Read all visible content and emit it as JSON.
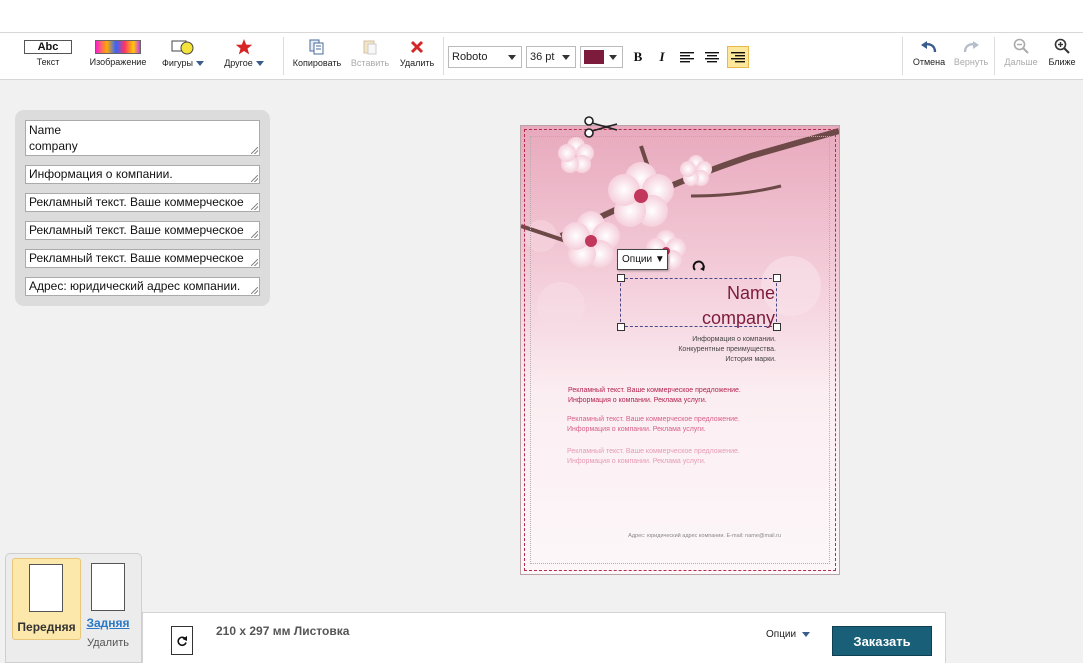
{
  "toolbar": {
    "text_label": "Текст",
    "text_icon": "Abc",
    "image_label": "Изображение",
    "shapes_label": "Фигуры",
    "other_label": "Другое",
    "copy_label": "Копировать",
    "paste_label": "Вставить",
    "delete_label": "Удалить",
    "font_family": "Roboto",
    "font_size": "36 pt",
    "text_color": "#7d1b3c",
    "bold": "B",
    "italic": "I",
    "undo_label": "Отмена",
    "redo_label": "Вернуть",
    "zoom_out_label": "Дальше",
    "zoom_in_label": "Ближе"
  },
  "fields": [
    {
      "line1": "Name",
      "line2": "company"
    },
    {
      "value": "Информация о компании."
    },
    {
      "value": "Рекламный текст. Ваше коммерческое"
    },
    {
      "value": "Рекламный текст. Ваше коммерческое"
    },
    {
      "value": "Рекламный текст. Ваше коммерческое"
    },
    {
      "value": "Адрес: юридический адрес компании."
    }
  ],
  "canvas": {
    "options_label": "Опции ▼",
    "name_line1": "Name",
    "name_line2": "company",
    "info_line1": "Информация о компании.",
    "info_line2": "Конкурентные преимущества.",
    "info_line3": "История марки.",
    "ad1_line1": "Рекламный текст. Ваше коммерческое предложение.",
    "ad1_line2": "Информация о компании. Реклама услуги.",
    "ad2_line1": "Рекламный текст. Ваше коммерческое предложение.",
    "ad2_line2": "Информация о компании. Реклама услуги.",
    "ad3_line1": "Рекламный текст. Ваше коммерческое предложение.",
    "ad3_line2": "Информация о компании. Реклама услуги.",
    "footer": "Адрес: юридический адрес компании. E-mail: name@mail.ru"
  },
  "pages": {
    "front_label": "Передняя",
    "back_label": "Задняя",
    "delete_label": "Удалить"
  },
  "bottom": {
    "size_text": "210 x 297 мм Листовка",
    "options_label": "Опции",
    "order_label": "Заказать"
  },
  "colors": {
    "accent": "#1a5f78",
    "brand_text": "#7d1b3c",
    "ad_dark": "#b3234f",
    "ad_mid": "#d9608a",
    "ad_light": "#e79ab6",
    "active_tab": "#fde8ab"
  }
}
